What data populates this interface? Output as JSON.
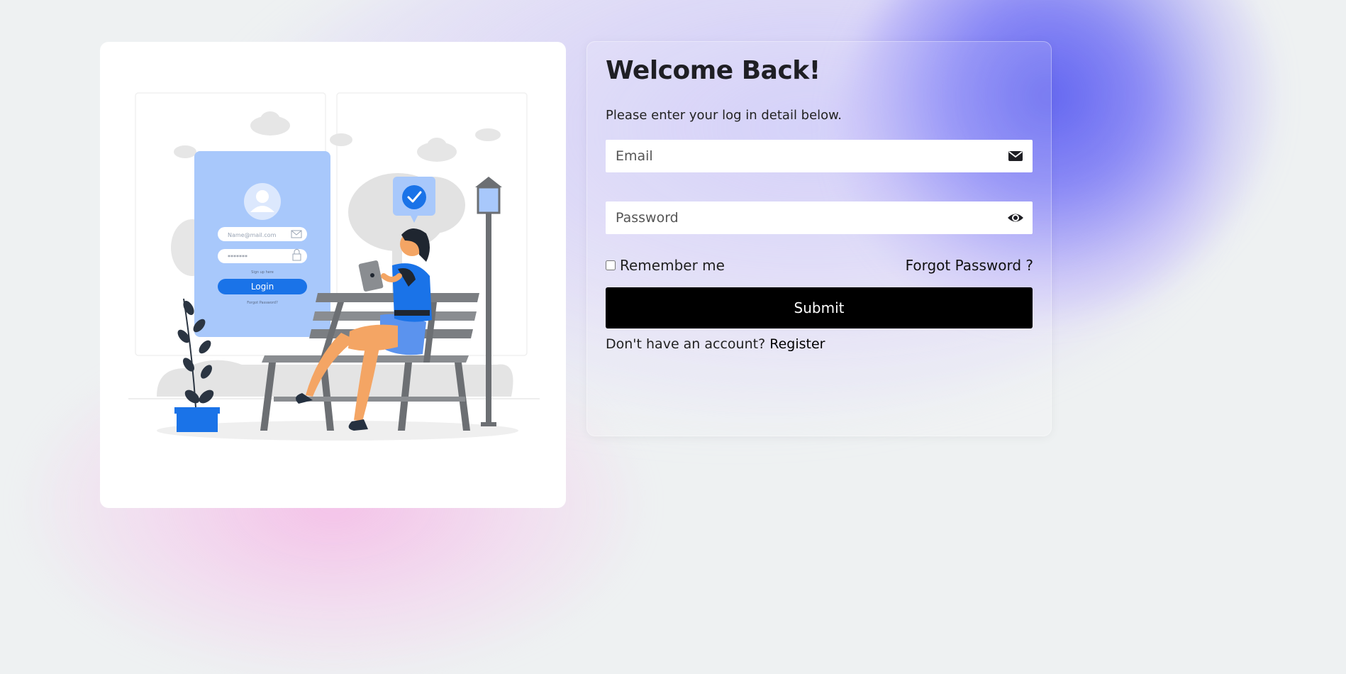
{
  "login": {
    "title": "Welcome Back!",
    "subtitle": "Please enter your log in detail below.",
    "email_placeholder": "Email",
    "password_placeholder": "Password",
    "remember_label": "Remember me",
    "forgot_label": "Forgot Password ?",
    "submit_label": "Submit",
    "no_account_text": "Don't have an account?",
    "register_label": "Register"
  },
  "illustration": {
    "email_placeholder": "Name@mail.com",
    "password_mask": "*******",
    "signup_text": "Sign up here",
    "login_button": "Login",
    "forgot_text": "Forgot Password?"
  },
  "icons": {
    "email": "envelope-icon",
    "password": "eye-icon"
  },
  "colors": {
    "accent_blue": "#1a73e8",
    "panel_blue": "#a8c8fb",
    "submit_bg": "#000000",
    "blob_blue": "#5c60f0",
    "blob_pink": "#f5b9e6"
  }
}
